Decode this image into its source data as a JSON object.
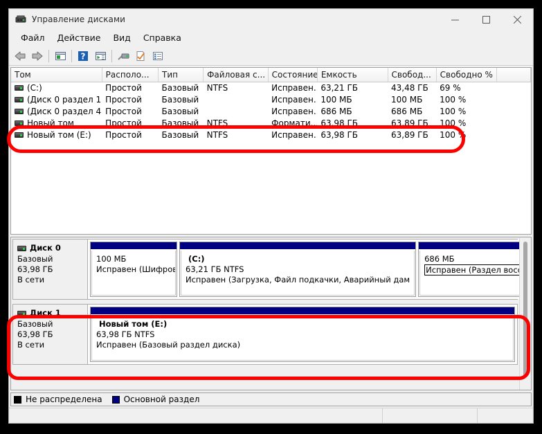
{
  "window": {
    "title": "Управление дисками",
    "icon": "disk-management-icon",
    "minimize_label": "—",
    "maximize_label": "□",
    "close_label": "✕"
  },
  "menu": {
    "items": [
      {
        "label": "Файл"
      },
      {
        "label": "Действие"
      },
      {
        "label": "Вид"
      },
      {
        "label": "Справка"
      }
    ]
  },
  "toolbar": {
    "buttons": [
      {
        "name": "back-icon"
      },
      {
        "name": "forward-icon"
      },
      {
        "name": "show-hide-console-tree-icon"
      },
      {
        "name": "help-icon"
      },
      {
        "name": "show-action-pane-icon"
      },
      {
        "name": "rescan-disks-icon"
      },
      {
        "name": "properties-icon"
      },
      {
        "name": "list-view-icon"
      }
    ]
  },
  "volume_table": {
    "columns": [
      "Том",
      "Располо...",
      "Тип",
      "Файловая с...",
      "Состояние",
      "Емкость",
      "Свобод...",
      "Свободно %",
      ""
    ],
    "rows": [
      {
        "volume": "(C:)",
        "layout": "Простой",
        "type": "Базовый",
        "fs": "NTFS",
        "status": "Исправен...",
        "capacity": "63,21 ГБ",
        "free": "43,48 ГБ",
        "free_pct": "69 %"
      },
      {
        "volume": "(Диск 0 раздел 1)",
        "layout": "Простой",
        "type": "Базовый",
        "fs": "",
        "status": "Исправен...",
        "capacity": "100 МБ",
        "free": "100 МБ",
        "free_pct": "100 %"
      },
      {
        "volume": "(Диск 0 раздел 4)",
        "layout": "Простой",
        "type": "Базовый",
        "fs": "",
        "status": "Исправен...",
        "capacity": "686 МБ",
        "free": "686 МБ",
        "free_pct": "100 %"
      },
      {
        "volume": "Новый том",
        "layout": "Простой",
        "type": "Базовый",
        "fs": "NTFS",
        "status": "Формати...",
        "capacity": "63,98 ГБ",
        "free": "63,89 ГБ",
        "free_pct": "100 %"
      },
      {
        "volume": "Новый том (E:)",
        "layout": "Простой",
        "type": "Базовый",
        "fs": "NTFS",
        "status": "Исправен...",
        "capacity": "63,98 ГБ",
        "free": "63,89 ГБ",
        "free_pct": "100 %"
      }
    ]
  },
  "disks": [
    {
      "name": "Диск 0",
      "type": "Базовый",
      "size": "63,98 ГБ",
      "state": "В сети",
      "partitions": [
        {
          "title": "",
          "size_fs": "100 МБ",
          "status": "Исправен (Шифрова",
          "color": "#000080"
        },
        {
          "title": "(C:)",
          "size_fs": "63,21 ГБ NTFS",
          "status": "Исправен (Загрузка, Файл подкачки, Аварийный дам",
          "color": "#000080"
        },
        {
          "title": "",
          "size_fs": "686 МБ",
          "status": "Исправен (Раздел восстановления)",
          "color": "#000080"
        }
      ]
    },
    {
      "name": "Диск 1",
      "type": "Базовый",
      "size": "63,98 ГБ",
      "state": "В сети",
      "partitions": [
        {
          "title": "Новый том  (E:)",
          "size_fs": "63,98 ГБ NTFS",
          "status": "Исправен (Базовый раздел диска)",
          "color": "#000080"
        }
      ]
    }
  ],
  "legend": {
    "entries": [
      {
        "label": "Не распределена",
        "color": "#000000"
      },
      {
        "label": "Основной раздел",
        "color": "#000080"
      }
    ]
  },
  "status_bar": {
    "cell1": "",
    "cell2": "",
    "cell3": ""
  },
  "annotations": {
    "highlight_color": "#fd0000",
    "boxes": [
      {
        "name": "highlight-new-volume-row"
      },
      {
        "name": "highlight-disk1"
      }
    ]
  }
}
